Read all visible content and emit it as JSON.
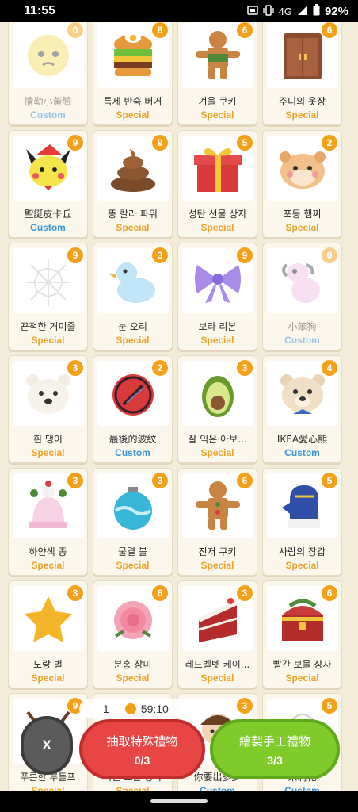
{
  "status_bar": {
    "time": "11:55",
    "network": "4G",
    "battery": "92%",
    "icons": [
      "notification-icon",
      "vibrate-icon",
      "signal-icon",
      "battery-icon"
    ]
  },
  "colors": {
    "special": "#f0a326",
    "custom": "#3b95d8",
    "badge": "#f4a11a",
    "background": "#f3ecd9"
  },
  "gifts": [
    {
      "name": "情勒小黃臉",
      "tag": "Custom",
      "count": "0",
      "icon": "worried-face-icon",
      "dim": true
    },
    {
      "name": "특제 반숙 버거",
      "tag": "Special",
      "count": "8",
      "icon": "burger-icon"
    },
    {
      "name": "겨울 쿠키",
      "tag": "Special",
      "count": "6",
      "icon": "gingerbread-cookie-icon"
    },
    {
      "name": "주디의 옷장",
      "tag": "Special",
      "count": "6",
      "icon": "wardrobe-icon"
    },
    {
      "name": "聖誕皮卡丘",
      "tag": "Custom",
      "count": "9",
      "icon": "christmas-pikachu-icon"
    },
    {
      "name": "똥 칼라 파워",
      "tag": "Special",
      "count": "9",
      "icon": "poop-icon"
    },
    {
      "name": "성탄 선물 상자",
      "tag": "Special",
      "count": "5",
      "icon": "gift-box-icon"
    },
    {
      "name": "포동 햄찌",
      "tag": "Special",
      "count": "2",
      "icon": "hamster-icon"
    },
    {
      "name": "끈적한 거미줄",
      "tag": "Special",
      "count": "9",
      "icon": "spider-web-icon"
    },
    {
      "name": "눈 오리",
      "tag": "Special",
      "count": "3",
      "icon": "snow-duck-icon"
    },
    {
      "name": "보라 리본",
      "tag": "Special",
      "count": "9",
      "icon": "purple-ribbon-icon"
    },
    {
      "name": "小笨狗",
      "tag": "Custom",
      "count": "0",
      "icon": "silly-dog-icon",
      "dim": true
    },
    {
      "name": "흰 댕이",
      "tag": "Special",
      "count": "3",
      "icon": "white-puppy-icon"
    },
    {
      "name": "最後的波紋",
      "tag": "Custom",
      "count": "2",
      "icon": "red-ball-icon"
    },
    {
      "name": "잘 익은 아보...",
      "tag": "Special",
      "count": "3",
      "icon": "avocado-icon"
    },
    {
      "name": "IKEA愛心熊",
      "tag": "Custom",
      "count": "4",
      "icon": "bear-icon"
    },
    {
      "name": "하얀색 종",
      "tag": "Special",
      "count": "3",
      "icon": "white-bell-icon"
    },
    {
      "name": "물결 볼",
      "tag": "Special",
      "count": "3",
      "icon": "ornament-ball-icon"
    },
    {
      "name": "진저 쿠키",
      "tag": "Special",
      "count": "6",
      "icon": "ginger-cookie-icon"
    },
    {
      "name": "사람의 장갑",
      "tag": "Special",
      "count": "5",
      "icon": "mitten-icon"
    },
    {
      "name": "노랑 별",
      "tag": "Special",
      "count": "3",
      "icon": "yellow-star-icon"
    },
    {
      "name": "분홍 장미",
      "tag": "Special",
      "count": "6",
      "icon": "pink-rose-icon"
    },
    {
      "name": "레드벨벳 케이...",
      "tag": "Special",
      "count": "3",
      "icon": "red-velvet-cake-icon"
    },
    {
      "name": "빨간 보물 상자",
      "tag": "Special",
      "count": "6",
      "icon": "treasure-chest-icon"
    },
    {
      "name": "푸른한 루돌프",
      "tag": "Special",
      "count": "9",
      "icon": "reindeer-icon"
    },
    {
      "name": "가든 보물 상자",
      "tag": "Special",
      "count": "",
      "icon": "garden-chest-icon"
    },
    {
      "name": "你要出多少",
      "tag": "Custom",
      "count": "3",
      "icon": "character-icon"
    },
    {
      "name": "茉莉花",
      "tag": "Custom",
      "count": "5",
      "icon": "jasmine-icon"
    }
  ],
  "timer": {
    "left": "1",
    "right": "59:10"
  },
  "actions": {
    "close_label": "X",
    "draw_label": "抽取特殊禮物",
    "draw_count": "0/3",
    "craft_label": "繪製手工禮物",
    "craft_count": "3/3"
  }
}
